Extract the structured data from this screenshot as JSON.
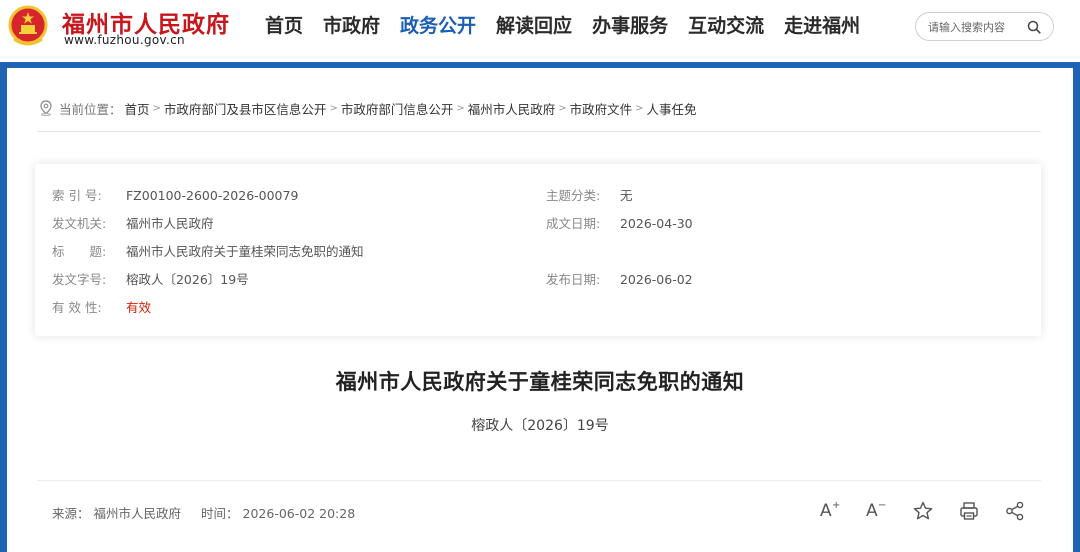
{
  "header": {
    "site_name": "福州市人民政府",
    "site_url": "www.fuzhou.gov.cn",
    "brand_color": "#c8161d",
    "accent_color": "#1a5fb4"
  },
  "nav": {
    "items": [
      {
        "label": "首页"
      },
      {
        "label": "市政府"
      },
      {
        "label": "政务公开",
        "active": true
      },
      {
        "label": "解读回应"
      },
      {
        "label": "办事服务"
      },
      {
        "label": "互动交流"
      },
      {
        "label": "走进福州"
      }
    ]
  },
  "search": {
    "placeholder": "请输入搜索内容",
    "icon": "search-icon"
  },
  "breadcrumb": {
    "prefix": "当前位置：",
    "items": [
      "首页",
      "市政府部门及县市区信息公开",
      "市政府部门信息公开",
      "福州市人民政府",
      "市政府文件",
      "人事任免"
    ]
  },
  "meta": {
    "index_label": "索 引 号:",
    "index_value": "FZ00100-2600-2026-00079",
    "topic_label": "主题分类:",
    "topic_value": "无",
    "issuer_label": "发文机关:",
    "issuer_value": "福州市人民政府",
    "created_label": "成文日期:",
    "created_value": "2026-04-30",
    "title_label": "标　　题:",
    "title_value": "福州市人民政府关于童桂荣同志免职的通知",
    "docno_label": "发文字号:",
    "docno_value": "榕政人〔2026〕19号",
    "published_label": "发布日期:",
    "published_value": "2026-06-02",
    "validity_label": "有 效 性:",
    "validity_value": "有效",
    "validity_color": "#d81e06"
  },
  "article": {
    "title": "福州市人民政府关于童桂荣同志免职的通知",
    "doc_number": "榕政人〔2026〕19号",
    "source_label": "来源：",
    "source_value": "福州市人民政府",
    "time_label": "时间：",
    "time_value": "2026-06-02 20:28"
  },
  "tools": {
    "font_increase": "A",
    "font_decrease": "A",
    "plus": "+",
    "minus": "−"
  }
}
